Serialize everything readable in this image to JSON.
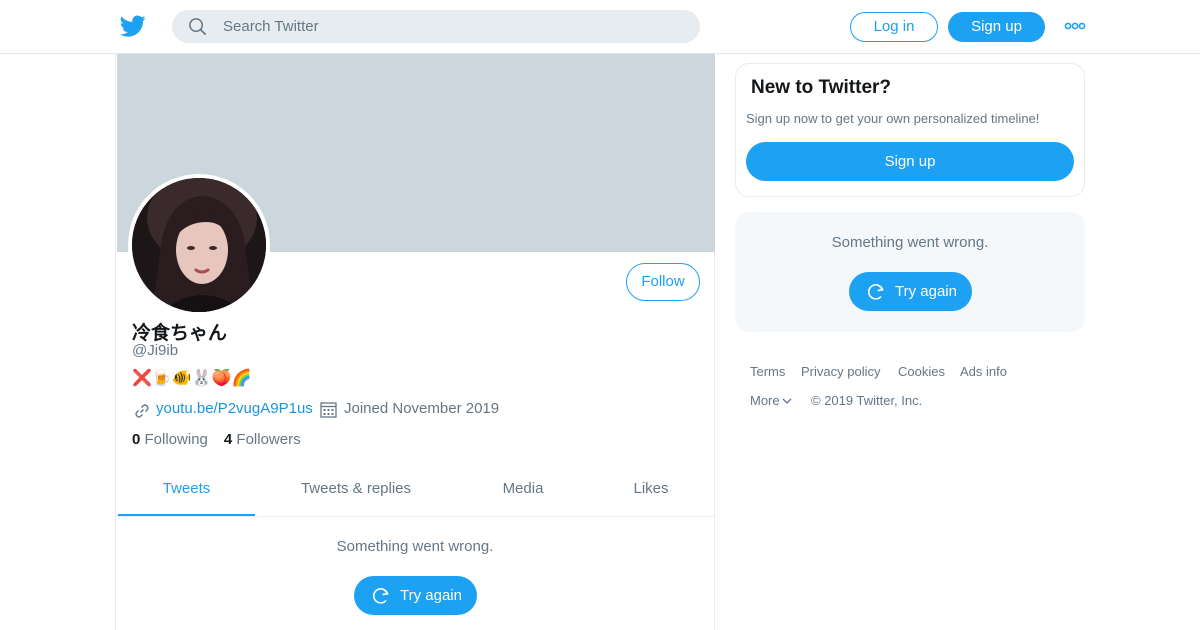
{
  "header": {
    "search_placeholder": "Search Twitter",
    "login_label": "Log in",
    "signup_label": "Sign up"
  },
  "profile": {
    "display_name": "冷食ちゃん",
    "handle": "@Ji9ib",
    "bio": "❌🍺🐠🐰🍑🌈",
    "link": "youtu.be/P2vugA9P1us",
    "joined": "Joined November 2019",
    "following_count": "0",
    "following_label": "Following",
    "followers_count": "4",
    "followers_label": "Followers",
    "follow_label": "Follow"
  },
  "tabs": [
    {
      "label": "Tweets",
      "active": true
    },
    {
      "label": "Tweets & replies",
      "active": false
    },
    {
      "label": "Media",
      "active": false
    },
    {
      "label": "Likes",
      "active": false
    }
  ],
  "timeline": {
    "error_text": "Something went wrong.",
    "retry_label": "Try again"
  },
  "sidebar": {
    "signup_card": {
      "title": "New to Twitter?",
      "text": "Sign up now to get your own personalized timeline!",
      "button_label": "Sign up"
    },
    "error_card": {
      "error_text": "Something went wrong.",
      "retry_label": "Try again"
    }
  },
  "footer": {
    "links": [
      "Terms",
      "Privacy policy",
      "Cookies",
      "Ads info"
    ],
    "more_label": "More",
    "copyright": "© 2019 Twitter, Inc."
  },
  "colors": {
    "accent": "#1da1f2",
    "link": "#1b95e0",
    "secondary_text": "#657786",
    "banner": "#ccd6dd"
  },
  "icons": [
    "twitter-bird-icon",
    "search-icon",
    "more-dots-icon",
    "link-icon",
    "calendar-icon",
    "refresh-icon",
    "chevron-down-icon"
  ]
}
